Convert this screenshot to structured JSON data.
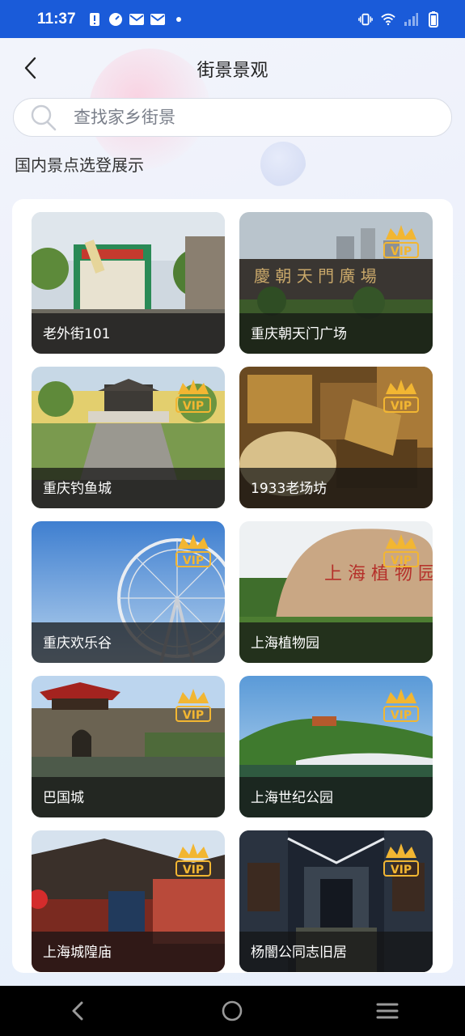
{
  "status_bar": {
    "time": "11:37"
  },
  "header": {
    "title": "街景景观"
  },
  "search": {
    "placeholder": "查找家乡街景"
  },
  "section_title": "国内景点选登展示",
  "spots": [
    {
      "name": "老外街101",
      "vip": false
    },
    {
      "name": "重庆朝天门广场",
      "vip": true
    },
    {
      "name": "重庆钓鱼城",
      "vip": true
    },
    {
      "name": "1933老场坊",
      "vip": true
    },
    {
      "name": "重庆欢乐谷",
      "vip": true
    },
    {
      "name": "上海植物园",
      "vip": true
    },
    {
      "name": "巴国城",
      "vip": true
    },
    {
      "name": "上海世纪公园",
      "vip": true
    },
    {
      "name": "上海城隍庙",
      "vip": true
    },
    {
      "name": "杨闇公同志旧居",
      "vip": true
    }
  ],
  "vip_badge_text": "VIP",
  "colors": {
    "status_bar": "#1a5bd9",
    "vip_gold": "#f2b632"
  }
}
